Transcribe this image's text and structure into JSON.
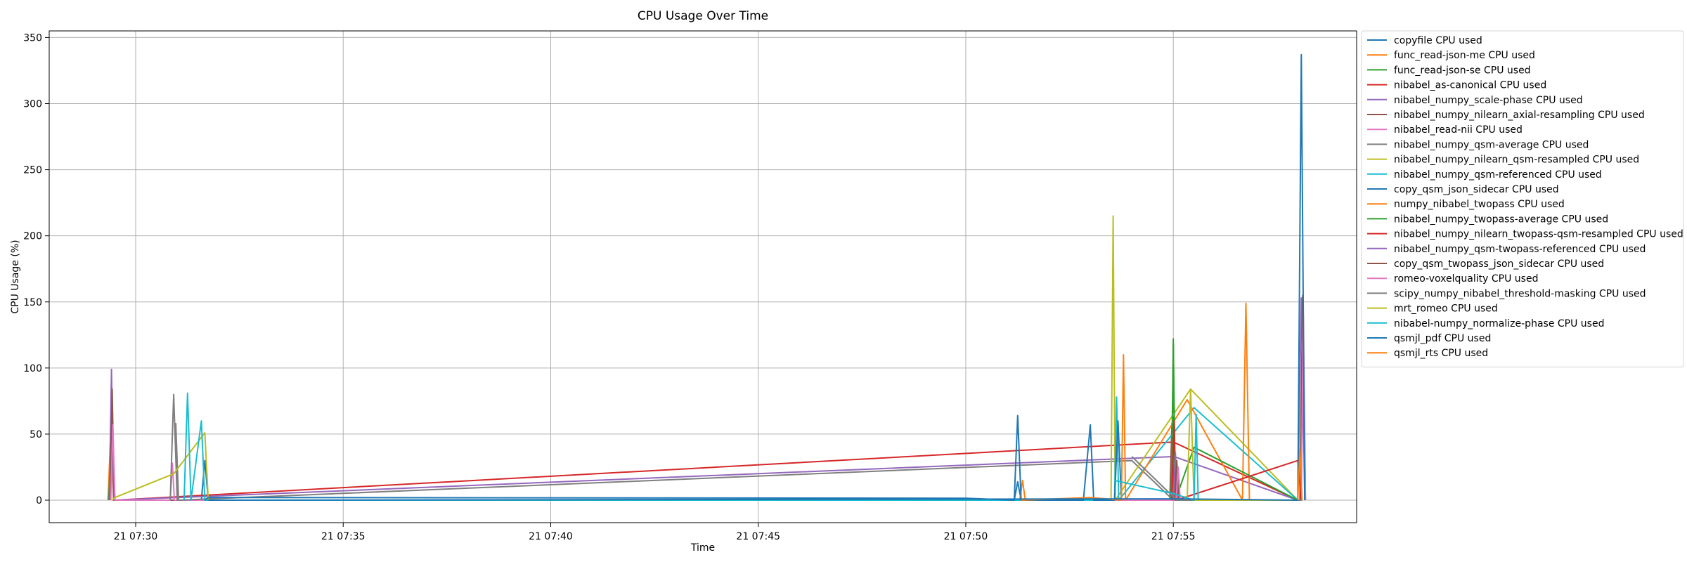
{
  "chart_data": {
    "type": "line",
    "title": "CPU Usage Over Time",
    "xlabel": "Time",
    "ylabel": "CPU Usage (%)",
    "x_unit": "time of day (hh:mm), day 21",
    "xlim": [
      "07:27:55",
      "07:59:25"
    ],
    "ylim": [
      -17,
      355
    ],
    "x_ticks": [
      {
        "t": "07:30",
        "label": "21 07:30"
      },
      {
        "t": "07:35",
        "label": "21 07:35"
      },
      {
        "t": "07:40",
        "label": "21 07:40"
      },
      {
        "t": "07:45",
        "label": "21 07:45"
      },
      {
        "t": "07:50",
        "label": "21 07:50"
      },
      {
        "t": "07:55",
        "label": "21 07:55"
      }
    ],
    "y_ticks": [
      0,
      50,
      100,
      150,
      200,
      250,
      300,
      350
    ],
    "grid": true,
    "legend_position": "outside right, top",
    "series": [
      {
        "name": "copyfile CPU used",
        "color": "#1f77b4",
        "points": [
          [
            "07:29:20",
            0
          ],
          [
            "07:29:25",
            45
          ],
          [
            "07:29:30",
            0
          ],
          [
            "07:31:35",
            0
          ],
          [
            "07:31:40",
            30
          ],
          [
            "07:31:45",
            0
          ],
          [
            "07:51:10",
            0
          ],
          [
            "07:51:15",
            14
          ],
          [
            "07:51:20",
            0
          ]
        ]
      },
      {
        "name": "func_read-json-me CPU used",
        "color": "#ff7f0e",
        "points": [
          [
            "07:29:20",
            0
          ],
          [
            "07:29:24",
            52
          ],
          [
            "07:29:28",
            0
          ],
          [
            "07:51:18",
            0
          ],
          [
            "07:51:22",
            15
          ],
          [
            "07:51:26",
            0
          ]
        ]
      },
      {
        "name": "func_read-json-se CPU used",
        "color": "#2ca02c",
        "points": [
          [
            "07:29:21",
            0
          ],
          [
            "07:29:25",
            50
          ],
          [
            "07:29:29",
            0
          ],
          [
            "07:54:58",
            0
          ],
          [
            "07:55:00",
            122
          ],
          [
            "07:55:02",
            0
          ]
        ]
      },
      {
        "name": "nibabel_as-canonical CPU used",
        "color": "#d62728",
        "points": [
          [
            "07:29:22",
            0
          ],
          [
            "07:29:26",
            48
          ],
          [
            "07:29:30",
            0
          ],
          [
            "07:55:00",
            44
          ],
          [
            "07:58:00",
            0
          ]
        ]
      },
      {
        "name": "nibabel_numpy_scale-phase CPU used",
        "color": "#9467bd",
        "points": [
          [
            "07:29:22",
            0
          ],
          [
            "07:29:25",
            99
          ],
          [
            "07:29:28",
            0
          ],
          [
            "07:55:01",
            33
          ],
          [
            "07:58:00",
            0
          ],
          [
            "07:58:05",
            153
          ],
          [
            "07:58:10",
            0
          ]
        ]
      },
      {
        "name": "nibabel_numpy_nilearn_axial-resampling CPU used",
        "color": "#8c564b",
        "points": [
          [
            "07:29:23",
            0
          ],
          [
            "07:29:26",
            84
          ],
          [
            "07:29:29",
            0
          ],
          [
            "07:54:55",
            0
          ],
          [
            "07:54:58",
            58
          ],
          [
            "07:55:01",
            0
          ],
          [
            "07:58:03",
            0
          ],
          [
            "07:58:07",
            155
          ],
          [
            "07:58:11",
            0
          ]
        ]
      },
      {
        "name": "nibabel_read-nii CPU used",
        "color": "#e377c2",
        "points": [
          [
            "07:29:24",
            0
          ],
          [
            "07:29:27",
            57
          ],
          [
            "07:29:30",
            0
          ],
          [
            "07:30:50",
            0
          ],
          [
            "07:30:53",
            28
          ],
          [
            "07:30:56",
            0
          ],
          [
            "07:58:05",
            0
          ],
          [
            "07:58:08",
            140
          ],
          [
            "07:58:11",
            0
          ]
        ]
      },
      {
        "name": "nibabel_numpy_qsm-average CPU used",
        "color": "#7f7f7f",
        "points": [
          [
            "07:30:50",
            0
          ],
          [
            "07:30:55",
            80
          ],
          [
            "07:31:00",
            0
          ],
          [
            "07:30:58",
            58
          ],
          [
            "07:31:02",
            0
          ],
          [
            "07:54:00",
            30
          ],
          [
            "07:55:00",
            0
          ]
        ]
      },
      {
        "name": "nibabel_numpy_nilearn_qsm-resampled CPU used",
        "color": "#bcbd22",
        "points": [
          [
            "07:29:26",
            0
          ],
          [
            "07:29:30",
            2
          ],
          [
            "07:30:55",
            20
          ],
          [
            "07:31:40",
            51
          ],
          [
            "07:31:45",
            0
          ],
          [
            "07:53:30",
            0
          ],
          [
            "07:53:33",
            215
          ],
          [
            "07:53:36",
            0
          ],
          [
            "07:55:25",
            84
          ],
          [
            "07:58:00",
            0
          ]
        ]
      },
      {
        "name": "nibabel_numpy_qsm-referenced CPU used",
        "color": "#17becf",
        "points": [
          [
            "07:31:10",
            0
          ],
          [
            "07:31:15",
            81
          ],
          [
            "07:31:20",
            0
          ],
          [
            "07:31:35",
            60
          ],
          [
            "07:31:40",
            0
          ],
          [
            "07:53:35",
            0
          ],
          [
            "07:53:38",
            78
          ],
          [
            "07:53:41",
            0
          ],
          [
            "07:55:30",
            70
          ],
          [
            "07:58:00",
            0
          ]
        ]
      },
      {
        "name": "copy_qsm_json_sidecar CPU used",
        "color": "#1f77b4",
        "points": [
          [
            "07:31:40",
            0
          ],
          [
            "07:31:45",
            2
          ],
          [
            "07:50:00",
            1.5
          ],
          [
            "07:51:10",
            0
          ],
          [
            "07:51:15",
            64
          ],
          [
            "07:51:20",
            0
          ],
          [
            "07:52:50",
            0
          ],
          [
            "07:53:00",
            57
          ],
          [
            "07:53:05",
            0
          ],
          [
            "07:53:35",
            0
          ],
          [
            "07:53:40",
            60
          ],
          [
            "07:53:45",
            0
          ]
        ]
      },
      {
        "name": "numpy_nibabel_twopass CPU used",
        "color": "#ff7f0e",
        "points": [
          [
            "07:51:20",
            0
          ],
          [
            "07:53:00",
            2
          ],
          [
            "07:53:45",
            0
          ],
          [
            "07:53:48",
            110
          ],
          [
            "07:53:51",
            0
          ],
          [
            "07:55:20",
            76
          ],
          [
            "07:56:40",
            0
          ],
          [
            "07:56:45",
            149
          ],
          [
            "07:56:50",
            0
          ]
        ]
      },
      {
        "name": "nibabel_numpy_twopass-average CPU used",
        "color": "#2ca02c",
        "points": [
          [
            "07:54:57",
            0
          ],
          [
            "07:55:00",
            118
          ],
          [
            "07:55:03",
            0
          ],
          [
            "07:55:30",
            40
          ],
          [
            "07:58:00",
            0
          ]
        ]
      },
      {
        "name": "nibabel_numpy_nilearn_twopass-qsm-resampled CPU used",
        "color": "#d62728",
        "points": [
          [
            "07:54:58",
            0
          ],
          [
            "07:55:01",
            60
          ],
          [
            "07:55:04",
            0
          ],
          [
            "07:58:00",
            30
          ],
          [
            "07:58:05",
            0
          ]
        ]
      },
      {
        "name": "nibabel_numpy_qsm-twopass-referenced CPU used",
        "color": "#9467bd",
        "points": [
          [
            "07:55:00",
            0
          ],
          [
            "07:55:03",
            36
          ],
          [
            "07:55:06",
            0
          ],
          [
            "07:58:00",
            0
          ]
        ]
      },
      {
        "name": "copy_qsm_twopass_json_sidecar CPU used",
        "color": "#8c564b",
        "points": [
          [
            "07:55:02",
            0
          ],
          [
            "07:55:05",
            30
          ],
          [
            "07:55:08",
            0
          ],
          [
            "07:58:02",
            0
          ]
        ]
      },
      {
        "name": "romeo-voxelquality CPU used",
        "color": "#e377c2",
        "points": [
          [
            "07:55:04",
            0
          ],
          [
            "07:55:07",
            25
          ],
          [
            "07:55:10",
            0
          ],
          [
            "07:58:04",
            0
          ]
        ]
      },
      {
        "name": "scipy_numpy_nibabel_threshold-masking CPU used",
        "color": "#7f7f7f",
        "points": [
          [
            "07:54:00",
            33
          ],
          [
            "07:55:05",
            0
          ],
          [
            "07:58:06",
            0
          ]
        ]
      },
      {
        "name": "mrt_romeo CPU used",
        "color": "#bcbd22",
        "points": [
          [
            "07:55:20",
            0
          ],
          [
            "07:55:25",
            84
          ],
          [
            "07:55:30",
            0
          ],
          [
            "07:58:00",
            0
          ]
        ]
      },
      {
        "name": "nibabel-numpy_normalize-phase CPU used",
        "color": "#17becf",
        "points": [
          [
            "07:53:35",
            15
          ],
          [
            "07:55:00",
            5
          ],
          [
            "07:55:30",
            0
          ],
          [
            "07:55:33",
            65
          ],
          [
            "07:55:36",
            0
          ]
        ]
      },
      {
        "name": "qsmjl_pdf CPU used",
        "color": "#1f77b4",
        "points": [
          [
            "07:31:45",
            0
          ],
          [
            "07:55:00",
            1
          ],
          [
            "07:58:00",
            0
          ],
          [
            "07:58:05",
            337
          ],
          [
            "07:58:10",
            0
          ]
        ]
      },
      {
        "name": "qsmjl_rts CPU used",
        "color": "#ff7f0e",
        "points": [
          [
            "07:58:00",
            0
          ],
          [
            "07:58:03",
            38
          ],
          [
            "07:58:06",
            0
          ]
        ]
      }
    ]
  }
}
